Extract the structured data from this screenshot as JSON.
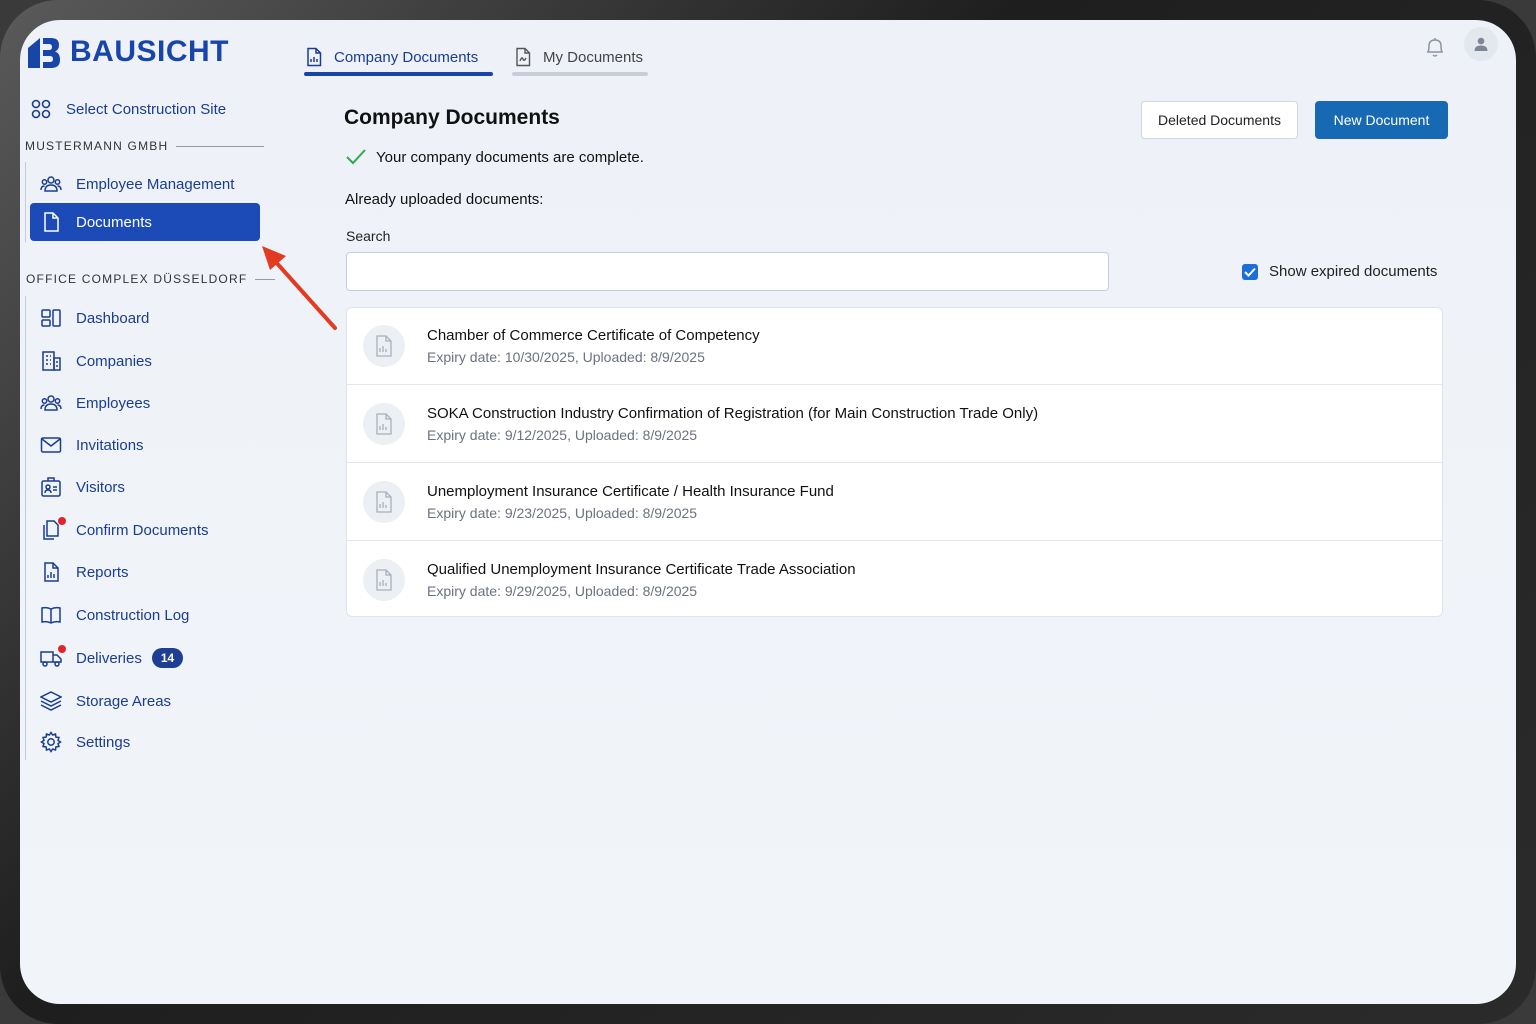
{
  "app": {
    "brand": "BAUSICHT"
  },
  "sidebar": {
    "select_site": "Select Construction Site",
    "section1": "MUSTERMANN GMBH",
    "section1_items": [
      {
        "label": "Employee Management",
        "icon": "users-icon"
      },
      {
        "label": "Documents",
        "icon": "document-icon",
        "active": true
      }
    ],
    "section2": "OFFICE COMPLEX DÜSSELDORF",
    "section2_items": [
      {
        "label": "Dashboard",
        "icon": "dashboard-icon"
      },
      {
        "label": "Companies",
        "icon": "building-icon"
      },
      {
        "label": "Employees",
        "icon": "users-icon"
      },
      {
        "label": "Invitations",
        "icon": "mail-icon"
      },
      {
        "label": "Visitors",
        "icon": "visitor-icon"
      },
      {
        "label": "Confirm Documents",
        "icon": "documents-icon",
        "notification": true
      },
      {
        "label": "Reports",
        "icon": "report-icon"
      },
      {
        "label": "Construction Log",
        "icon": "book-icon"
      },
      {
        "label": "Deliveries",
        "icon": "truck-icon",
        "notification": true,
        "badge": "14"
      },
      {
        "label": "Storage Areas",
        "icon": "layers-icon"
      },
      {
        "label": "Settings",
        "icon": "gear-icon"
      }
    ]
  },
  "tabs": [
    {
      "label": "Company Documents",
      "active": true
    },
    {
      "label": "My Documents",
      "active": false
    }
  ],
  "main": {
    "title": "Company Documents",
    "status": "Your company documents are complete.",
    "already_uploaded": "Already uploaded documents:",
    "search_label": "Search",
    "search_value": "",
    "show_expired_label": "Show expired documents",
    "show_expired_checked": true,
    "deleted_button": "Deleted Documents",
    "new_button": "New Document",
    "documents": [
      {
        "title": "Chamber of Commerce Certificate of Competency",
        "meta": "Expiry date: 10/30/2025, Uploaded: 8/9/2025"
      },
      {
        "title": "SOKA Construction Industry Confirmation of Registration (for Main Construction Trade Only)",
        "meta": "Expiry date: 9/12/2025, Uploaded: 8/9/2025"
      },
      {
        "title": "Unemployment Insurance Certificate / Health Insurance Fund",
        "meta": "Expiry date: 9/23/2025, Uploaded: 8/9/2025"
      },
      {
        "title": "Qualified Unemployment Insurance Certificate Trade Association",
        "meta": "Expiry date: 9/29/2025, Uploaded: 8/9/2025"
      }
    ]
  },
  "colors": {
    "brand": "#1846a8",
    "active_nav": "#1c4bb8",
    "primary_button": "#1769b3",
    "notification": "#e0242b",
    "annotation_arrow": "#e23b22"
  }
}
